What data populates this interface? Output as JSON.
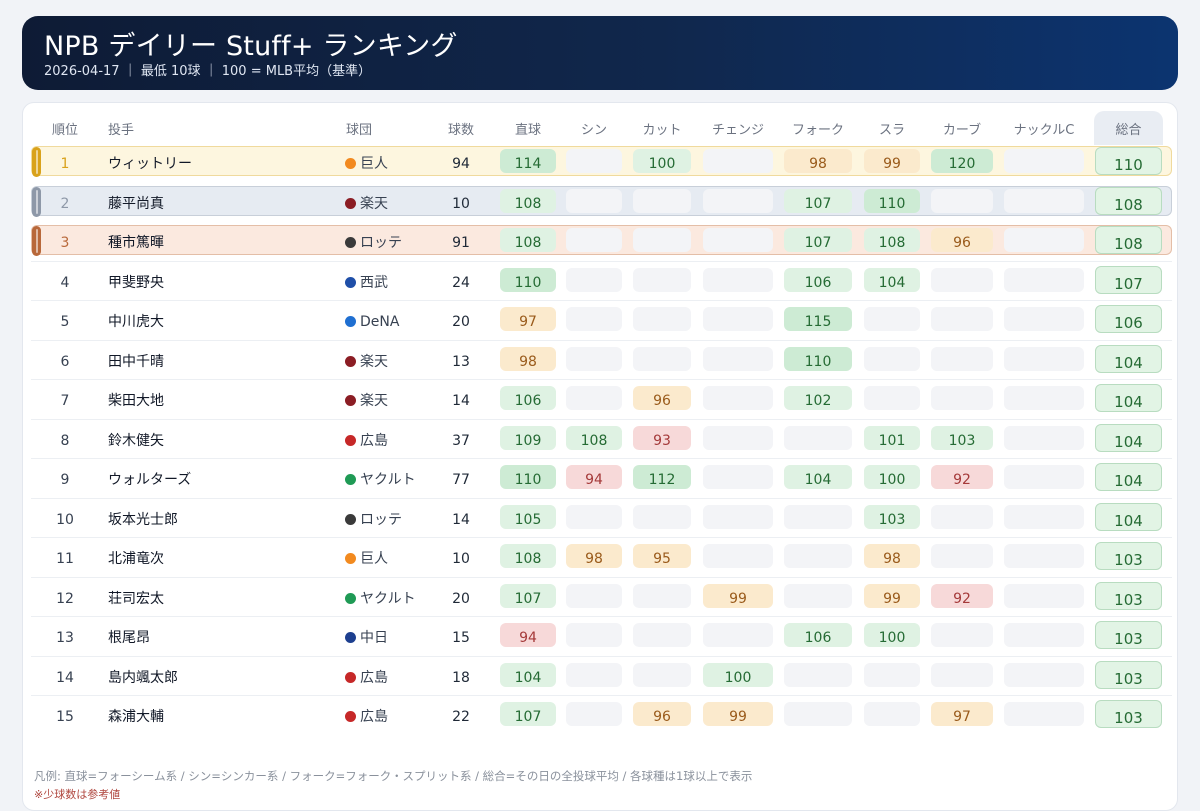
{
  "header": {
    "title": "NPB デイリー Stuff+ ランキング",
    "subtitle": "2026-04-17 ｜ 最低 10球 ｜ 100 = MLB平均（基準）"
  },
  "columns": {
    "rank": "順位",
    "pitcher": "投手",
    "team": "球団",
    "pitches": "球数",
    "fastball": "直球",
    "sinker": "シン",
    "cutter": "カット",
    "changeup": "チェンジ",
    "fork": "フォーク",
    "slider": "スラ",
    "curve": "カーブ",
    "knuckle_curve": "ナックルC",
    "total": "総合"
  },
  "top3_colors": [
    "#d9a21b",
    "#8e98a8",
    "#b8683a"
  ],
  "top3_band_colors": [
    "#fdf6df",
    "#e6ebf2",
    "#fbe9df"
  ],
  "rows": [
    {
      "rank": "1",
      "pitcher": "ウィットリー",
      "team": "巨人",
      "team_color": "#f28a1f",
      "pitches": "94",
      "stuff": {
        "fastball": 114,
        "sinker": null,
        "cutter": 100,
        "changeup": null,
        "fork": 98,
        "slider": 99,
        "curve": 120,
        "knuckle_curve": null
      },
      "total": "110"
    },
    {
      "rank": "2",
      "pitcher": "藤平尚真",
      "team": "楽天",
      "team_color": "#8b1d24",
      "pitches": "10",
      "stuff": {
        "fastball": 108,
        "sinker": null,
        "cutter": null,
        "changeup": null,
        "fork": 107,
        "slider": 110,
        "curve": null,
        "knuckle_curve": null
      },
      "total": "108"
    },
    {
      "rank": "3",
      "pitcher": "種市篤暉",
      "team": "ロッテ",
      "team_color": "#3a3a3a",
      "pitches": "91",
      "stuff": {
        "fastball": 108,
        "sinker": null,
        "cutter": null,
        "changeup": null,
        "fork": 107,
        "slider": 108,
        "curve": 96,
        "knuckle_curve": null
      },
      "total": "108"
    },
    {
      "rank": "4",
      "pitcher": "甲斐野央",
      "team": "西武",
      "team_color": "#1f4fa8",
      "pitches": "24",
      "stuff": {
        "fastball": 110,
        "sinker": null,
        "cutter": null,
        "changeup": null,
        "fork": 106,
        "slider": 104,
        "curve": null,
        "knuckle_curve": null
      },
      "total": "107"
    },
    {
      "rank": "5",
      "pitcher": "中川虎大",
      "team": "DeNA",
      "team_color": "#1f6fd1",
      "pitches": "20",
      "stuff": {
        "fastball": 97,
        "sinker": null,
        "cutter": null,
        "changeup": null,
        "fork": 115,
        "slider": null,
        "curve": null,
        "knuckle_curve": null
      },
      "total": "106"
    },
    {
      "rank": "6",
      "pitcher": "田中千晴",
      "team": "楽天",
      "team_color": "#8b1d24",
      "pitches": "13",
      "stuff": {
        "fastball": 98,
        "sinker": null,
        "cutter": null,
        "changeup": null,
        "fork": 110,
        "slider": null,
        "curve": null,
        "knuckle_curve": null
      },
      "total": "104"
    },
    {
      "rank": "7",
      "pitcher": "柴田大地",
      "team": "楽天",
      "team_color": "#8b1d24",
      "pitches": "14",
      "stuff": {
        "fastball": 106,
        "sinker": null,
        "cutter": 96,
        "changeup": null,
        "fork": 102,
        "slider": null,
        "curve": null,
        "knuckle_curve": null
      },
      "total": "104"
    },
    {
      "rank": "8",
      "pitcher": "鈴木健矢",
      "team": "広島",
      "team_color": "#c62828",
      "pitches": "37",
      "stuff": {
        "fastball": 109,
        "sinker": 108,
        "cutter": 93,
        "changeup": null,
        "fork": null,
        "slider": 101,
        "curve": 103,
        "knuckle_curve": null
      },
      "total": "104"
    },
    {
      "rank": "9",
      "pitcher": "ウォルターズ",
      "team": "ヤクルト",
      "team_color": "#1f9a55",
      "pitches": "77",
      "stuff": {
        "fastball": 110,
        "sinker": 94,
        "cutter": 112,
        "changeup": null,
        "fork": 104,
        "slider": 100,
        "curve": 92,
        "knuckle_curve": null
      },
      "total": "104"
    },
    {
      "rank": "10",
      "pitcher": "坂本光士郎",
      "team": "ロッテ",
      "team_color": "#3a3a3a",
      "pitches": "14",
      "stuff": {
        "fastball": 105,
        "sinker": null,
        "cutter": null,
        "changeup": null,
        "fork": null,
        "slider": 103,
        "curve": null,
        "knuckle_curve": null
      },
      "total": "104"
    },
    {
      "rank": "11",
      "pitcher": "北浦竜次",
      "team": "巨人",
      "team_color": "#f28a1f",
      "pitches": "10",
      "stuff": {
        "fastball": 108,
        "sinker": 98,
        "cutter": 95,
        "changeup": null,
        "fork": null,
        "slider": 98,
        "curve": null,
        "knuckle_curve": null
      },
      "total": "103"
    },
    {
      "rank": "12",
      "pitcher": "荘司宏太",
      "team": "ヤクルト",
      "team_color": "#1f9a55",
      "pitches": "20",
      "stuff": {
        "fastball": 107,
        "sinker": null,
        "cutter": null,
        "changeup": 99,
        "fork": null,
        "slider": 99,
        "curve": 92,
        "knuckle_curve": null
      },
      "total": "103"
    },
    {
      "rank": "13",
      "pitcher": "根尾昂",
      "team": "中日",
      "team_color": "#1d3f8f",
      "pitches": "15",
      "stuff": {
        "fastball": 94,
        "sinker": null,
        "cutter": null,
        "changeup": null,
        "fork": 106,
        "slider": 100,
        "curve": null,
        "knuckle_curve": null
      },
      "total": "103"
    },
    {
      "rank": "14",
      "pitcher": "島内颯太郎",
      "team": "広島",
      "team_color": "#c62828",
      "pitches": "18",
      "stuff": {
        "fastball": 104,
        "sinker": null,
        "cutter": null,
        "changeup": 100,
        "fork": null,
        "slider": null,
        "curve": null,
        "knuckle_curve": null
      },
      "total": "103"
    },
    {
      "rank": "15",
      "pitcher": "森浦大輔",
      "team": "広島",
      "team_color": "#c62828",
      "pitches": "22",
      "stuff": {
        "fastball": 107,
        "sinker": null,
        "cutter": 96,
        "changeup": 99,
        "fork": null,
        "slider": null,
        "curve": 97,
        "knuckle_curve": null
      },
      "total": "103"
    }
  ],
  "footer": {
    "legend": "凡例: 直球=フォーシーム系 / シン=シンカー系 / フォーク=フォーク・スプリット系 / 総合=その日の全投球平均 / 各球種は1球以上で表示",
    "note": "※少球数は参考値"
  }
}
